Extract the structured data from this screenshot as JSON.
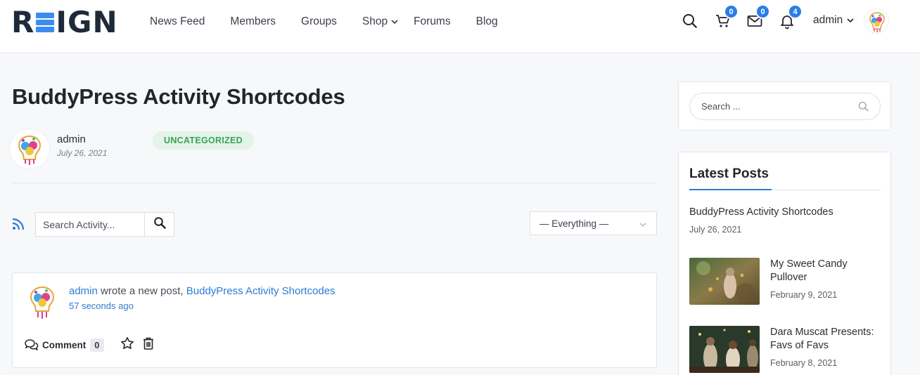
{
  "header": {
    "logo_letter_r": "R",
    "logo_letters_ign": "IGN",
    "nav": [
      {
        "label": "News Feed"
      },
      {
        "label": "Members"
      },
      {
        "label": "Groups"
      },
      {
        "label": "Shop"
      },
      {
        "label": "Forums"
      },
      {
        "label": "Blog"
      }
    ],
    "cart_count": "0",
    "messages_count": "0",
    "notifications_count": "4",
    "user_name": "admin"
  },
  "post": {
    "title": "BuddyPress Activity Shortcodes",
    "author": "admin",
    "date": "July 26, 2021",
    "category": "UNCATEGORIZED"
  },
  "activity": {
    "search_placeholder": "Search Activity...",
    "filter_selected": "— Everything —",
    "items": [
      {
        "user": "admin",
        "action_text": " wrote a new post, ",
        "post_link": "BuddyPress Activity Shortcodes",
        "time": "57 seconds ago",
        "comment_label": "Comment",
        "comment_count": "0"
      }
    ]
  },
  "sidebar": {
    "search_placeholder": "Search ...",
    "latest_posts_title": "Latest Posts",
    "posts": [
      {
        "title": "BuddyPress Activity Shortcodes",
        "date": "July 26, 2021"
      },
      {
        "title_line1": "My Sweet Candy",
        "title_line2": "Pullover",
        "date": "February 9, 2021"
      },
      {
        "title_line1": "Dara Muscat Presents:",
        "title_line2": "Favs of Favs",
        "date": "February 8, 2021"
      }
    ]
  },
  "colors": {
    "accent": "#2f7bd1",
    "badge": "#2b7de9",
    "category_bg": "#e4f4e8",
    "category_text": "#37a35a"
  }
}
